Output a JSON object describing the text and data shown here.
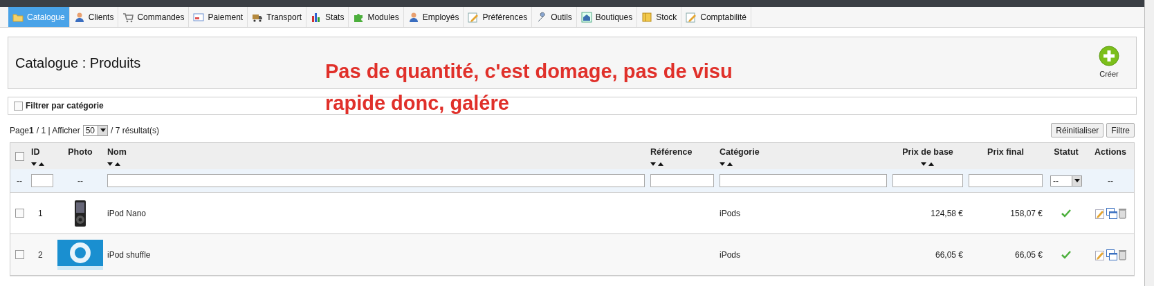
{
  "tabs": [
    {
      "label": "Catalogue",
      "selected": true,
      "kind": "folder"
    },
    {
      "label": "Clients",
      "selected": false,
      "kind": "person"
    },
    {
      "label": "Commandes",
      "selected": false,
      "kind": "cart"
    },
    {
      "label": "Paiement",
      "selected": false,
      "kind": "card"
    },
    {
      "label": "Transport",
      "selected": false,
      "kind": "truck"
    },
    {
      "label": "Stats",
      "selected": false,
      "kind": "chart"
    },
    {
      "label": "Modules",
      "selected": false,
      "kind": "puzzle"
    },
    {
      "label": "Employés",
      "selected": false,
      "kind": "person"
    },
    {
      "label": "Préférences",
      "selected": false,
      "kind": "pencil"
    },
    {
      "label": "Outils",
      "selected": false,
      "kind": "wrench"
    },
    {
      "label": "Boutiques",
      "selected": false,
      "kind": "house"
    },
    {
      "label": "Stock",
      "selected": false,
      "kind": "box"
    },
    {
      "label": "Comptabilité",
      "selected": false,
      "kind": "pencil"
    }
  ],
  "page_title": "Catalogue : Produits",
  "create_button": "Créer",
  "annotation": "Pas de quantité, c'est domage, pas de visu rapide donc, galére",
  "category_filter": {
    "label": "Filtrer par catégorie",
    "checked": false
  },
  "pagination": {
    "page_label": "Page",
    "page": "1",
    "pages": "/ 1 | Afficher",
    "per_page": "50",
    "results": "/ 7 résultat(s)"
  },
  "buttons": [
    "Réinitialiser",
    "Filtre"
  ],
  "table": {
    "select_all_checked": false,
    "columns": [
      {
        "label": "ID",
        "sortable": true
      },
      {
        "label": "Photo",
        "sortable": false
      },
      {
        "label": "Nom",
        "sortable": true
      },
      {
        "label": "Référence",
        "sortable": true
      },
      {
        "label": "Catégorie",
        "sortable": true
      },
      {
        "label": "Prix de base",
        "sortable": true
      },
      {
        "label": "Prix final",
        "sortable": false
      },
      {
        "label": "Statut",
        "sortable": false
      },
      {
        "label": "Actions",
        "sortable": false
      }
    ],
    "filters": [
      {
        "kind": "dash",
        "text": "--"
      },
      {
        "kind": "input"
      },
      {
        "kind": "dash",
        "text": "--"
      },
      {
        "kind": "input"
      },
      {
        "kind": "input"
      },
      {
        "kind": "input"
      },
      {
        "kind": "input"
      },
      {
        "kind": "input"
      },
      {
        "kind": "select",
        "text": "--"
      },
      {
        "kind": "dash",
        "text": "--"
      }
    ],
    "rows": [
      {
        "checked": false,
        "id": "1",
        "name": "iPod Nano",
        "category": "iPods",
        "base_price": "124,58 €",
        "final_price": "158,07 €",
        "active": true
      },
      {
        "checked": false,
        "id": "2",
        "name": "iPod shuffle",
        "category": "iPods",
        "base_price": "66,05 €",
        "final_price": "66,05 €",
        "active": true
      }
    ]
  }
}
